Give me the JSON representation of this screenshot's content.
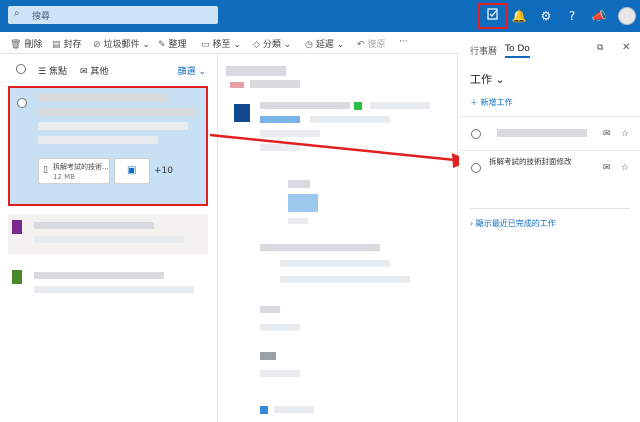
{
  "topbar": {
    "search_placeholder": "搜尋",
    "icons": [
      "todo-icon",
      "bell-icon",
      "gear-icon",
      "help-icon",
      "megaphone-icon",
      "avatar"
    ]
  },
  "commands": [
    {
      "label": "刪除",
      "icon": "trash-icon"
    },
    {
      "label": "封存",
      "icon": "archive-icon"
    },
    {
      "label": "垃圾郵件",
      "icon": "block-icon"
    },
    {
      "label": "整理",
      "icon": "broom-icon"
    },
    {
      "label": "移至",
      "icon": "folder-move-icon"
    },
    {
      "label": "分類",
      "icon": "tag-icon"
    },
    {
      "label": "延遲",
      "icon": "clock-icon"
    },
    {
      "label": "復原",
      "icon": "undo-icon"
    },
    {
      "label": "···",
      "icon": "more-icon"
    }
  ],
  "list": {
    "tab_focused": "焦點",
    "tab_other": "其他",
    "filter": "篩選",
    "selected_mail": {
      "attachment_name": "拆解考試的技術...",
      "attachment_size": "12 MB",
      "more_count": "+10"
    }
  },
  "todo": {
    "tab_calendar": "行事曆",
    "tab_todo": "To Do",
    "list_title": "工作",
    "add_task": "新增工作",
    "tasks": [
      {
        "text": ""
      },
      {
        "text": "拆解考試的技術封面修改"
      }
    ],
    "show_completed": "顯示最近已完成的工作"
  },
  "colors": {
    "brand": "#0f6cbd",
    "highlight": "#e02020",
    "selected_row": "#c7e0f4"
  }
}
